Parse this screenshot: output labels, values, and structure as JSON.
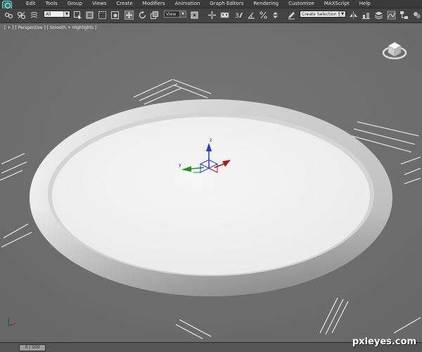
{
  "menubar": {
    "items": [
      {
        "label": "Edit"
      },
      {
        "label": "Tools"
      },
      {
        "label": "Group"
      },
      {
        "label": "Views"
      },
      {
        "label": "Create"
      },
      {
        "label": "Modifiers"
      },
      {
        "label": "Animation"
      },
      {
        "label": "Graph Editors"
      },
      {
        "label": "Rendering"
      },
      {
        "label": "Customize"
      },
      {
        "label": "MAXScript"
      },
      {
        "label": "Help"
      }
    ]
  },
  "toolbar": {
    "selection_filter": "All",
    "reference_coordinate": "View",
    "named_selection": "Create Selection Se",
    "snap_label": "3"
  },
  "viewport": {
    "label": "[ + ] [ Perspective ] [ Smooth + Highlights ]",
    "gizmo_z_label": "z",
    "gizmo_y_label": "y"
  },
  "timeline": {
    "frame_readout": "0 / 100"
  },
  "watermark": "pxleyes.com",
  "colors": {
    "viewport_bg": "#6f6f6f",
    "axis_x": "#b01818",
    "axis_y": "#1a9a1a",
    "axis_z": "#1a3ad0"
  }
}
